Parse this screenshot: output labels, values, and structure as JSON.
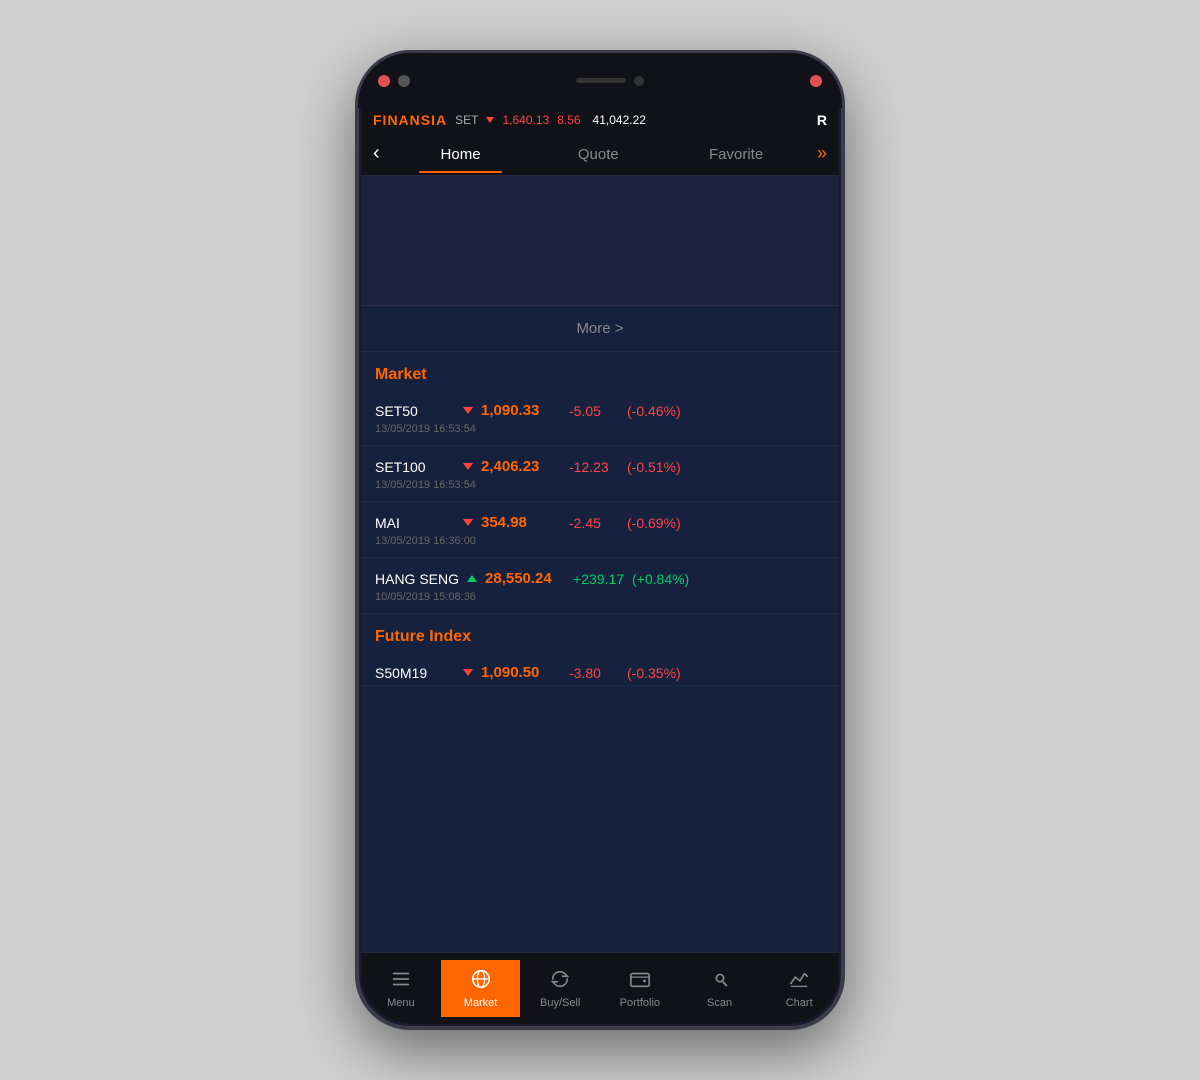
{
  "brand": "FINANSIA",
  "status_bar": {
    "set_label": "SET",
    "set_value": "1,640.13",
    "set_change": "8.56",
    "index_value": "41,042.22",
    "r_icon": "R"
  },
  "nav": {
    "back_label": "‹",
    "tabs": [
      {
        "label": "Home",
        "active": true
      },
      {
        "label": "Quote",
        "active": false
      },
      {
        "label": "Favorite",
        "active": false
      }
    ],
    "more_icon": "»"
  },
  "more_btn": "More >",
  "market_section": {
    "title": "Market",
    "items": [
      {
        "name": "SET50",
        "direction": "down",
        "price": "1,090.33",
        "change": "-5.05",
        "pct": "(-0.46%)",
        "timestamp": "13/05/2019  16:53:54",
        "positive": false
      },
      {
        "name": "SET100",
        "direction": "down",
        "price": "2,406.23",
        "change": "-12.23",
        "pct": "(-0.51%)",
        "timestamp": "13/05/2019  16:53:54",
        "positive": false
      },
      {
        "name": "MAI",
        "direction": "down",
        "price": "354.98",
        "change": "-2.45",
        "pct": "(-0.69%)",
        "timestamp": "13/05/2019  16:36:00",
        "positive": false
      },
      {
        "name": "HANG SENG",
        "direction": "up",
        "price": "28,550.24",
        "change": "+239.17",
        "pct": "(+0.84%)",
        "timestamp": "10/05/2019  15:08:36",
        "positive": true
      }
    ]
  },
  "future_index_section": {
    "title": "Future Index",
    "items": [
      {
        "name": "S50M19",
        "direction": "down",
        "price": "1,090.50",
        "change": "-3.80",
        "pct": "(-0.35%)",
        "positive": false
      }
    ]
  },
  "bottom_nav": {
    "items": [
      {
        "label": "Menu",
        "icon": "menu",
        "active": false
      },
      {
        "label": "Market",
        "icon": "globe",
        "active": true
      },
      {
        "label": "Buy/Sell",
        "icon": "refresh",
        "active": false
      },
      {
        "label": "Portfolio",
        "icon": "wallet",
        "active": false
      },
      {
        "label": "Scan",
        "icon": "scan",
        "active": false
      },
      {
        "label": "Chart",
        "icon": "chart",
        "active": false
      }
    ]
  }
}
